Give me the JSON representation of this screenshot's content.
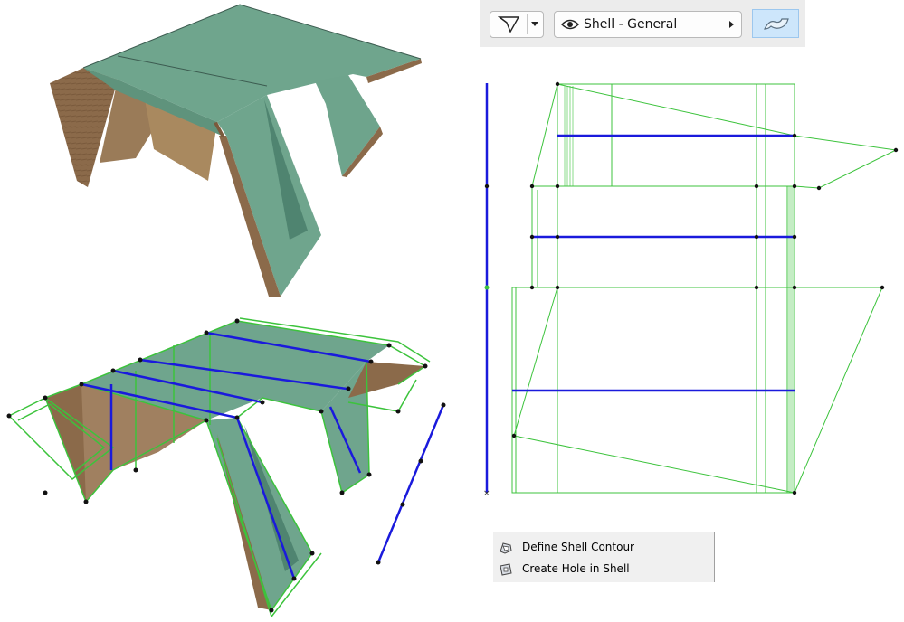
{
  "toolbar": {
    "geometry_method_icon": "shell-geometry-icon",
    "view_icon": "eye-icon",
    "view_label": "Shell - General",
    "shell_tool_icon": "shell-surface-icon"
  },
  "context_menu": {
    "items": [
      {
        "label": "Define Shell Contour",
        "icon": "shell-contour-icon"
      },
      {
        "label": "Create Hole in Shell",
        "icon": "shell-hole-icon"
      }
    ]
  },
  "colors": {
    "roof": "#6fa58d",
    "roof_dark": "#4f8470",
    "wood": "#8b6a4a",
    "selection": "#3cc33c",
    "axis_blue": "#1a1adc",
    "toolbar_bg": "#ececec",
    "active_button": "#cde6fb"
  }
}
